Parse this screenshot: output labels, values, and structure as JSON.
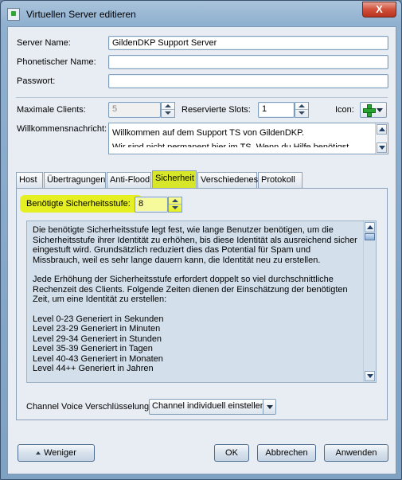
{
  "window": {
    "title": "Virtuellen Server editieren",
    "close_label": "X"
  },
  "server": {
    "name_label": "Server Name:",
    "name_value": "GildenDKP Support Server",
    "phonetic_label": "Phonetischer Name:",
    "phonetic_value": "",
    "password_label": "Passwort:",
    "password_value": ""
  },
  "limits": {
    "max_clients_label": "Maximale Clients:",
    "max_clients_value": "5",
    "reserved_slots_label": "Reservierte Slots:",
    "reserved_slots_value": "1",
    "icon_label": "Icon:",
    "icon_name": "plus-icon"
  },
  "welcome": {
    "label": "Willkommensnachricht:",
    "line1": "Willkommen auf dem Support TS von GildenDKP.",
    "line2": "Wir sind nicht permanent hier im TS. Wenn du Hilfe benötigst"
  },
  "tabs": [
    {
      "label": "Host"
    },
    {
      "label": "Übertragungen"
    },
    {
      "label": "Anti-Flood"
    },
    {
      "label": "Sicherheit"
    },
    {
      "label": "Verschiedenes"
    },
    {
      "label": "Protokoll"
    }
  ],
  "security": {
    "level_label": "Benötigte Sicherheitsstufe:",
    "level_value": "8",
    "description_p1": "Die benötigte Sicherheitsstufe legt fest, wie lange Benutzer benötigen, um die Sicherheitsstufe ihrer Identität zu erhöhen, bis diese Identität als ausreichend sicher eingestuft wird. Grundsätzlich reduziert dies das Potential für Spam und Missbrauch, weil es sehr lange dauern kann, die Identität neu zu erstellen.",
    "description_p2": "Jede Erhöhung der Sicherheitsstufe erfordert doppelt so viel durchschnittliche Rechenzeit des Clients. Folgende Zeiten dienen der Einschätzung der benötigten Zeit, um eine Identität zu erstellen:",
    "levels": [
      "Level 0-23 Generiert in Sekunden",
      "Level 23-29 Generiert in Minuten",
      "Level 29-34 Generiert in Stunden",
      "Level 35-39 Generiert in Tagen",
      "Level 40-43 Generiert in Monaten",
      "Level 44++ Generiert in Jahren"
    ]
  },
  "voice": {
    "label": "Channel Voice Verschlüsselung:",
    "selected": "Channel individuell einstellen"
  },
  "buttons": {
    "less": "Weniger",
    "ok": "OK",
    "cancel": "Abbrechen",
    "apply": "Anwenden"
  },
  "colors": {
    "highlight": "#e5ef22",
    "active_tab": "#d8e62a",
    "title_gradient_top": "#a9c3db"
  }
}
